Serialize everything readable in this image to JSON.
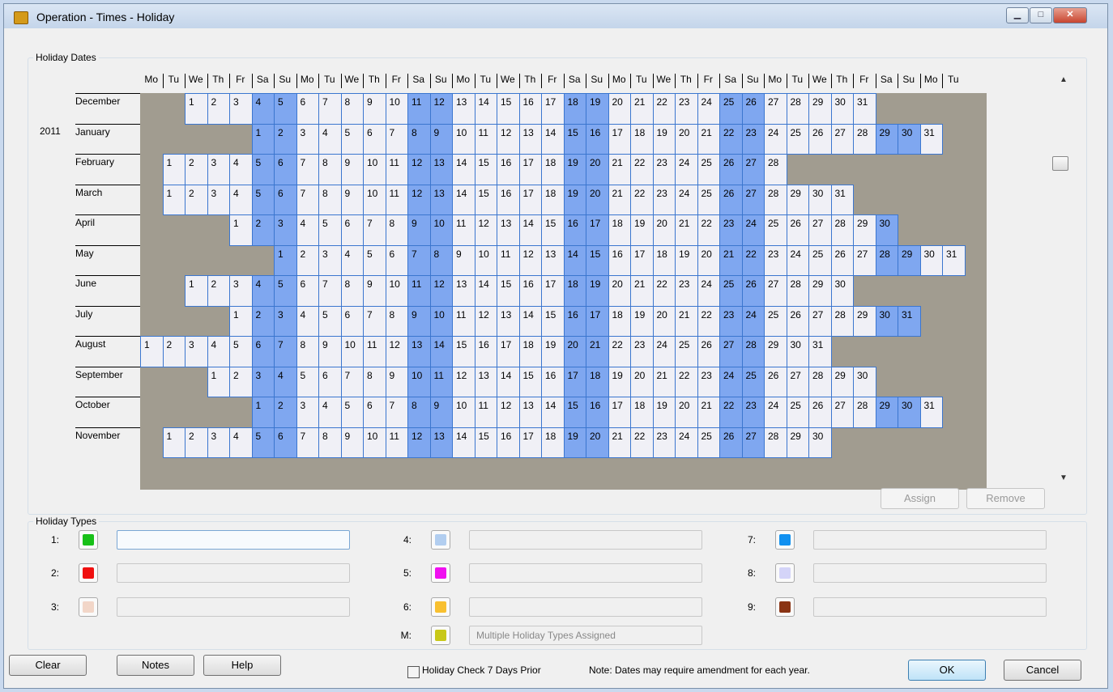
{
  "window": {
    "title": "Operation - Times - Holiday",
    "minimize_icon": "minimize-icon",
    "restore_icon": "restore-icon",
    "close_icon": "close-icon"
  },
  "holiday_dates": {
    "legend": "Holiday Dates",
    "year": "2011",
    "weekday_headers": [
      "Mo",
      "Tu",
      "We",
      "Th",
      "Fr",
      "Sa",
      "Su",
      "Mo",
      "Tu",
      "We",
      "Th",
      "Fr",
      "Sa",
      "Su",
      "Mo",
      "Tu",
      "We",
      "Th",
      "Fr",
      "Sa",
      "Su",
      "Mo",
      "Tu",
      "We",
      "Th",
      "Fr",
      "Sa",
      "Su",
      "Mo",
      "Tu",
      "We",
      "Th",
      "Fr",
      "Sa",
      "Su",
      "Mo",
      "Tu"
    ],
    "months": [
      {
        "name": "December",
        "offset": 2,
        "days": 31
      },
      {
        "name": "January",
        "offset": 5,
        "days": 31
      },
      {
        "name": "February",
        "offset": 1,
        "days": 28
      },
      {
        "name": "March",
        "offset": 1,
        "days": 31
      },
      {
        "name": "April",
        "offset": 4,
        "days": 30
      },
      {
        "name": "May",
        "offset": 6,
        "days": 31
      },
      {
        "name": "June",
        "offset": 2,
        "days": 30
      },
      {
        "name": "July",
        "offset": 4,
        "days": 31
      },
      {
        "name": "August",
        "offset": 0,
        "days": 31
      },
      {
        "name": "September",
        "offset": 3,
        "days": 30
      },
      {
        "name": "October",
        "offset": 5,
        "days": 31
      },
      {
        "name": "November",
        "offset": 1,
        "days": 30
      }
    ],
    "buttons": {
      "assign": "Assign",
      "remove": "Remove"
    }
  },
  "holiday_types": {
    "legend": "Holiday Types",
    "types": [
      {
        "label": "1:",
        "color": "#18c018",
        "value": ""
      },
      {
        "label": "2:",
        "color": "#f01010",
        "value": ""
      },
      {
        "label": "3:",
        "color": "#f2d6c8",
        "value": ""
      },
      {
        "label": "4:",
        "color": "#b2cef0",
        "value": ""
      },
      {
        "label": "5:",
        "color": "#f010f0",
        "value": ""
      },
      {
        "label": "6:",
        "color": "#f8c030",
        "value": ""
      },
      {
        "label": "7:",
        "color": "#1090f0",
        "value": ""
      },
      {
        "label": "8:",
        "color": "#d4d4f8",
        "value": ""
      },
      {
        "label": "9:",
        "color": "#8a3414",
        "value": ""
      }
    ],
    "multiple": {
      "label": "M:",
      "color": "#c8c818",
      "value": "Multiple Holiday Types Assigned"
    }
  },
  "footer": {
    "clear": "Clear",
    "notes": "Notes",
    "help": "Help",
    "checkbox_label": "Holiday Check 7 Days Prior",
    "checkbox_checked": false,
    "note": "Note: Dates may require amendment for each year.",
    "ok": "OK",
    "cancel": "Cancel"
  }
}
